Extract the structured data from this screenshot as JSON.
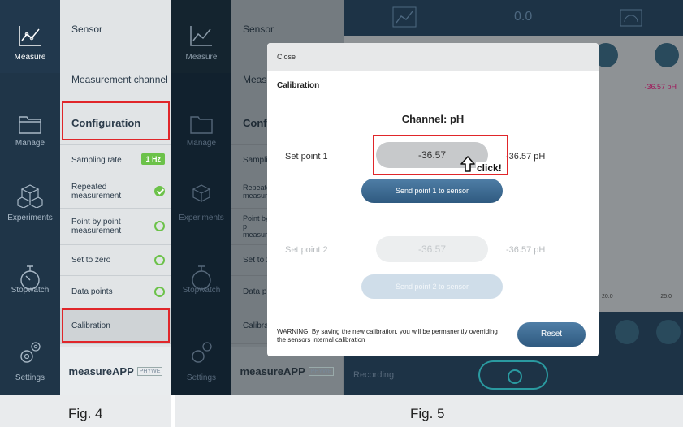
{
  "fig4": {
    "nav": [
      {
        "label": "Measure",
        "icon": "line-chart-icon",
        "active": true
      },
      {
        "label": "Manage",
        "icon": "folder-icon"
      },
      {
        "label": "Experiments",
        "icon": "cubes-icon"
      },
      {
        "label": "Stopwatch",
        "icon": "stopwatch-icon"
      },
      {
        "label": "Settings",
        "icon": "settings-gears-icon"
      }
    ],
    "sidebar": {
      "sensor": "Sensor",
      "measurement_channel": "Measurement channel",
      "configuration": "Configuration",
      "sampling_rate": "Sampling rate",
      "sampling_rate_value": "1 Hz",
      "repeated": "Repeated measurement",
      "point_by_point": "Point by point measurement",
      "set_to_zero": "Set to zero",
      "data_points": "Data points",
      "calibration": "Calibration",
      "logo": "measureAPP",
      "brand": "PHYWE"
    },
    "caption": "Fig. 4"
  },
  "fig5": {
    "nav": [
      {
        "label": "Measure"
      },
      {
        "label": "Manage"
      },
      {
        "label": "Experiments"
      },
      {
        "label": "Stopwatch"
      },
      {
        "label": "Settings"
      }
    ],
    "sidebar": {
      "sensor": "Sensor",
      "measurement": "Measur",
      "configuration": "Configu",
      "sampling": "Sampling",
      "repeated": "Repeated measurem",
      "point": "Point by p measurem",
      "set_to_zero": "Set to zer",
      "data_points": "Data poin",
      "calibration": "Calibratio",
      "logo": "measureAPP",
      "brand": "PHYWE"
    },
    "topbar": {
      "value": "0.0"
    },
    "chart": {
      "readout": "-36.57 pH",
      "tick_a": "20.0",
      "tick_b": "25.0"
    },
    "bottom": {
      "recording": "Recording"
    },
    "modal": {
      "close": "Close",
      "title": "Calibration",
      "channel": "Channel: pH",
      "set_point_1": {
        "label": "Set point 1",
        "value": "-36.57",
        "unit": "-36.57 pH",
        "button": "Send point 1 to sensor"
      },
      "set_point_2": {
        "label": "Set point 2",
        "value": "-36.57",
        "unit": "-36.57 pH",
        "button": "Send point 2 to sensor"
      },
      "warning": "WARNING: By saving the new calibration, you will be permanently overriding the sensors internal calibration",
      "reset": "Reset",
      "click_hint": "click!"
    },
    "caption": "Fig. 5"
  },
  "colors": {
    "accent_green": "#6cc24a",
    "highlight_red": "#e0262a",
    "button_blue": "#3a6a93",
    "nav_dark": "#1f3548"
  }
}
